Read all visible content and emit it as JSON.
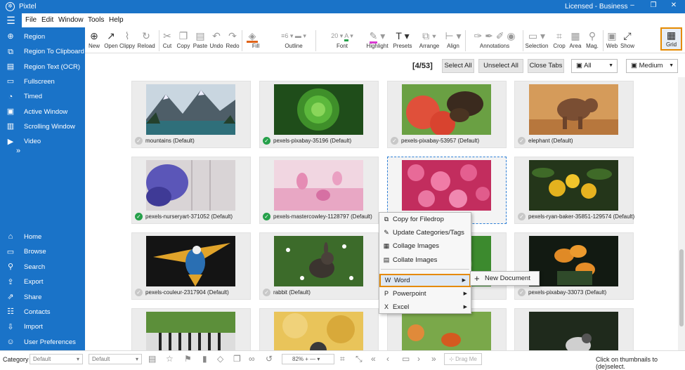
{
  "app": {
    "title": "Pixtel",
    "license": "Licensed - Business"
  },
  "menu": [
    "File",
    "Edit",
    "Window",
    "Tools",
    "Help"
  ],
  "sidebar_top": [
    {
      "label": "Region",
      "icon": "region-icon",
      "glyph": "⊕"
    },
    {
      "label": "Region To Clipboard",
      "icon": "clipboard-icon",
      "glyph": "⧉"
    },
    {
      "label": "Region Text (OCR)",
      "icon": "ocr-text-icon",
      "glyph": "▤"
    },
    {
      "label": "Fullscreen",
      "icon": "fullscreen-icon",
      "glyph": "▭"
    },
    {
      "label": "Timed",
      "icon": "timer-icon",
      "glyph": "◔"
    },
    {
      "label": "Active Window",
      "icon": "window-icon",
      "glyph": "▣"
    },
    {
      "label": "Scrolling Window",
      "icon": "scroll-window-icon",
      "glyph": "▥"
    },
    {
      "label": "Video",
      "icon": "video-icon",
      "glyph": "▶"
    }
  ],
  "sidebar_expand": "»",
  "sidebar_bottom": [
    {
      "label": "Home",
      "icon": "home-icon",
      "glyph": "⌂"
    },
    {
      "label": "Browse",
      "icon": "browse-icon",
      "glyph": "▭"
    },
    {
      "label": "Search",
      "icon": "search-icon",
      "glyph": "⚲"
    },
    {
      "label": "Export",
      "icon": "export-icon",
      "glyph": "⇪"
    },
    {
      "label": "Share",
      "icon": "share-icon",
      "glyph": "⇗"
    },
    {
      "label": "Contacts",
      "icon": "contacts-icon",
      "glyph": "☷"
    },
    {
      "label": "Import",
      "icon": "import-icon",
      "glyph": "⇩"
    },
    {
      "label": "User Preferences",
      "icon": "user-icon",
      "glyph": "☺"
    }
  ],
  "toolbar": {
    "new": "New",
    "open": "Open",
    "clippy": "Clippy",
    "reload": "Reload",
    "cut": "Cut",
    "copy": "Copy",
    "paste": "Paste",
    "undo": "Undo",
    "redo": "Redo",
    "fill": "Fill",
    "outline": "Outline",
    "outline_size": "6",
    "font": "Font",
    "font_size": "20",
    "highlight": "Highlight",
    "presets": "Presets",
    "arrange": "Arrange",
    "align": "Align",
    "annotations": "Annotations",
    "selection": "Selection",
    "crop": "Crop",
    "area": "Area",
    "mag": "Mag.",
    "web": "Web",
    "show": "Show",
    "grid": "Grid"
  },
  "subbar": {
    "counter": "[4/53]",
    "select_all": "Select All",
    "unselect_all": "Unselect All",
    "close_tabs": "Close Tabs",
    "filter": "All",
    "size": "Medium"
  },
  "thumbnails": [
    {
      "name": "mountains (Default)",
      "checked": false,
      "kind": "mountains"
    },
    {
      "name": "pexels-pixabay-35196 (Default)",
      "checked": true,
      "kind": "succulent"
    },
    {
      "name": "pexels-pixabay-53957 (Default)",
      "checked": false,
      "kind": "butterfly"
    },
    {
      "name": "elephant  (Default)",
      "checked": false,
      "kind": "elephant"
    },
    {
      "name": "pexels-nurseryart-371052 (Default)",
      "checked": true,
      "kind": "lavender"
    },
    {
      "name": "pexels-mastercowley-1128797 (Default)",
      "checked": true,
      "kind": "pinkfield"
    },
    {
      "name": "",
      "checked": false,
      "kind": "pinkflowers"
    },
    {
      "name": "pexels-ryan-baker-35851-129574 (Default)",
      "checked": false,
      "kind": "lemons"
    },
    {
      "name": "pexels-couleur-2317904 (Default)",
      "checked": false,
      "kind": "parrot"
    },
    {
      "name": "rabbit (Default)",
      "checked": false,
      "kind": "rabbit"
    },
    {
      "name": "",
      "checked": false,
      "kind": "green"
    },
    {
      "name": "pexels-pixabay-33073 (Default)",
      "checked": false,
      "kind": "butterflies"
    },
    {
      "name": "",
      "checked": false,
      "kind": "zebra"
    },
    {
      "name": "",
      "checked": false,
      "kind": "autumn"
    },
    {
      "name": "",
      "checked": false,
      "kind": "bird"
    },
    {
      "name": "",
      "checked": false,
      "kind": "sparrow"
    }
  ],
  "context_menu": {
    "items": [
      {
        "label": "Copy for Filedrop",
        "icon": "filedrop-icon",
        "glyph": "⧉",
        "arrow": ""
      },
      {
        "label": "Update Categories/Tags",
        "icon": "tags-icon",
        "glyph": "✎",
        "arrow": ""
      },
      {
        "label": "Collage Images",
        "icon": "collage-icon",
        "glyph": "▦",
        "arrow": ""
      },
      {
        "label": "Collate Images",
        "icon": "collate-icon",
        "glyph": "▤",
        "arrow": ""
      },
      {
        "label": "Word",
        "icon": "word-icon",
        "glyph": "W",
        "arrow": "▶"
      },
      {
        "label": "Powerpoint",
        "icon": "powerpoint-icon",
        "glyph": "P",
        "arrow": "▶"
      },
      {
        "label": "Excel",
        "icon": "excel-icon",
        "glyph": "X",
        "arrow": "▶"
      }
    ],
    "submenu": "New Document"
  },
  "bottombar": {
    "category_label": "Category",
    "category_value": "Default",
    "second_value": "Default",
    "zoom": "82%",
    "drag": "Drag Me",
    "status": "Click on thumbnails to (de)select."
  },
  "colors": {
    "accent": "#1a73c8",
    "highlight": "#e58a00",
    "check": "#26a04a"
  }
}
